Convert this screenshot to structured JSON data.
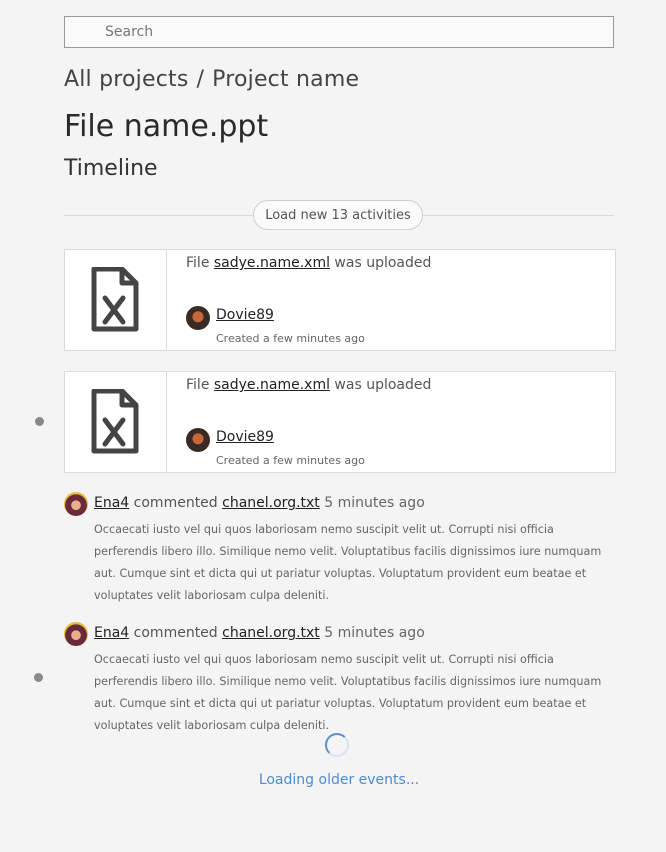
{
  "search": {
    "placeholder": "Search"
  },
  "breadcrumb": {
    "root": "All projects",
    "separator": "/",
    "project": "Project name"
  },
  "page_title": "File name.ppt",
  "section_title": "Timeline",
  "load_new_label": "Load new 13 activities",
  "file_events": [
    {
      "prefix": "File",
      "filename": "sadye.name.xml",
      "suffix": "was uploaded",
      "author": "Dovie89",
      "created": "Created a few minutes ago",
      "icon": "excel-file-icon"
    },
    {
      "prefix": "File",
      "filename": "sadye.name.xml",
      "suffix": "was uploaded",
      "author": "Dovie89",
      "created": "Created a few minutes ago",
      "icon": "excel-file-icon"
    }
  ],
  "comments": [
    {
      "author": "Ena4",
      "verb": "commented",
      "target": "chanel.org.txt",
      "time": "5 minutes ago",
      "body": "Occaecati iusto vel qui quos laboriosam nemo suscipit velit ut. Corrupti nisi officia perferendis libero illo. Similique nemo velit. Voluptatibus facilis dignissimos iure numquam aut. Cumque sint et dicta qui ut pariatur voluptas. Voluptatum provident eum beatae et voluptates velit laboriosam culpa deleniti."
    },
    {
      "author": "Ena4",
      "verb": "commented",
      "target": "chanel.org.txt",
      "time": "5 minutes ago",
      "body": "Occaecati iusto vel qui quos laboriosam nemo suscipit velit ut. Corrupti nisi officia perferendis libero illo. Similique nemo velit. Voluptatibus facilis dignissimos iure numquam aut. Cumque sint et dicta qui ut pariatur voluptas. Voluptatum provident eum beatae et voluptates velit laboriosam culpa deleniti."
    }
  ],
  "loading_label": "Loading older events...",
  "colors": {
    "accent": "#4f8ad0",
    "background": "#f4f4f4",
    "timeline_dot": "#888888"
  }
}
